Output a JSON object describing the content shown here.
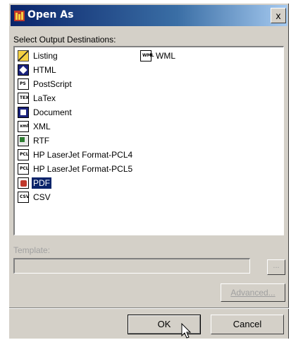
{
  "window": {
    "title": "Open As",
    "close_glyph": "x"
  },
  "destinations": {
    "label": "Select Output Destinations:",
    "items": [
      {
        "label": "Listing",
        "icon": "listing-icon",
        "selected": false
      },
      {
        "label": "HTML",
        "icon": "html-icon",
        "selected": false
      },
      {
        "label": "PostScript",
        "icon": "postscript-icon",
        "tag": "PS",
        "selected": false
      },
      {
        "label": "LaTex",
        "icon": "latex-icon",
        "tag": "TEX",
        "selected": false
      },
      {
        "label": "Document",
        "icon": "document-icon",
        "selected": false
      },
      {
        "label": "XML",
        "icon": "xml-icon",
        "tag": "xml",
        "selected": false
      },
      {
        "label": "RTF",
        "icon": "rtf-icon",
        "selected": false
      },
      {
        "label": "HP LaserJet Format-PCL4",
        "icon": "pcl-icon",
        "tag": "PCL",
        "selected": false
      },
      {
        "label": "HP LaserJet Format-PCL5",
        "icon": "pcl-icon",
        "tag": "PCL",
        "selected": false
      },
      {
        "label": "PDF",
        "icon": "pdf-icon",
        "selected": true
      },
      {
        "label": "CSV",
        "icon": "csv-icon",
        "tag": "CSV",
        "selected": false
      },
      {
        "label": "WML",
        "icon": "wml-icon",
        "tag": "WML",
        "selected": false
      }
    ]
  },
  "template": {
    "label": "Template:",
    "value": "",
    "browse_label": "..."
  },
  "buttons": {
    "advanced": "Advanced...",
    "ok": "OK",
    "cancel": "Cancel"
  },
  "colors": {
    "title_start": "#0a246a",
    "selection": "#0a246a",
    "face": "#d4d0c8"
  }
}
